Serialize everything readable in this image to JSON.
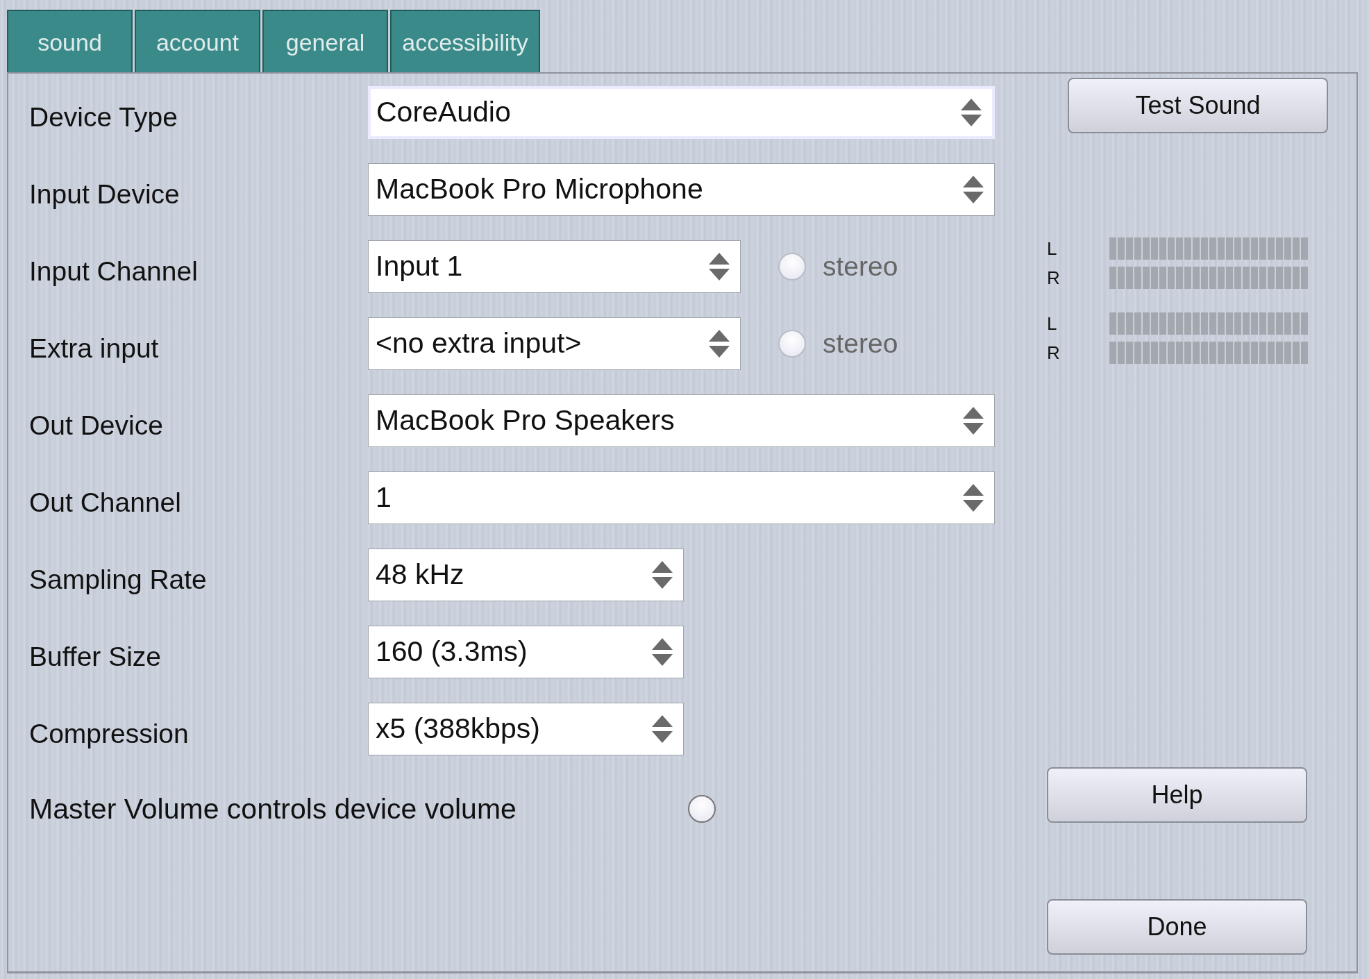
{
  "tabs": [
    {
      "label": "sound",
      "selected": false
    },
    {
      "label": "account",
      "selected": false
    },
    {
      "label": "general",
      "selected": false
    },
    {
      "label": "accessibility",
      "selected": false
    }
  ],
  "settings": [
    {
      "label": "Device Type",
      "value": "CoreAudio",
      "focused": true
    },
    {
      "label": "Input Device",
      "value": "MacBook Pro Microphone",
      "focused": false
    },
    {
      "label": "Input Channel",
      "value": "Input 1",
      "focused": false,
      "option": {
        "label": "stereo",
        "checked": false,
        "disabled": true
      }
    },
    {
      "label": "Extra input",
      "value": "<no extra input>",
      "focused": false,
      "option": {
        "label": "stereo",
        "checked": false,
        "disabled": true
      }
    },
    {
      "label": "Out Device",
      "value": "MacBook Pro Speakers",
      "focused": false
    },
    {
      "label": "Out Channel",
      "value": "1",
      "focused": false
    },
    {
      "label": "Sampling Rate",
      "value": "48 kHz",
      "focused": false
    },
    {
      "label": "Buffer Size",
      "value": "160 (3.3ms)",
      "focused": false
    },
    {
      "label": "Compression",
      "value": "x5 (388kbps)",
      "focused": false
    }
  ],
  "master_volume": {
    "label": "Master Volume controls device volume",
    "checked": false
  },
  "test_sound_button": "Test Sound",
  "meters": [
    {
      "channels": [
        {
          "label": "L"
        },
        {
          "label": "R"
        }
      ]
    },
    {
      "channels": [
        {
          "label": "L"
        },
        {
          "label": "R"
        }
      ]
    }
  ],
  "help_button": "Help",
  "done_button": "Done"
}
